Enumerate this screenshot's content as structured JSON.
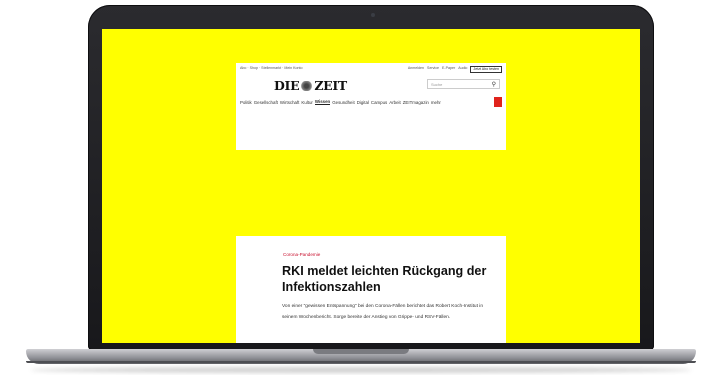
{
  "header": {
    "topbar_left": "Abo · Shop · Stellenmarkt · Mein Konto",
    "topbar_right_items": [
      "Anmelden",
      "Service",
      "E-Paper",
      "Audio"
    ],
    "topbar_login": "Jetzt Abo testen",
    "logo_left": "DIE",
    "logo_right": "ZEIT",
    "search_placeholder": "Suche",
    "nav": [
      "Politik",
      "Gesellschaft",
      "Wirtschaft",
      "Kultur",
      "Wissen",
      "Gesundheit",
      "Digital",
      "Campus",
      "Arbeit",
      "ZEITmagazin",
      "mehr"
    ],
    "nav_active_index": 4
  },
  "article": {
    "kicker": "Corona-Pandemie",
    "headline": "RKI meldet leichten Rückgang der Infektionszahlen",
    "teaser": "Von einer \"gewissen Entspannung\" bei den Corona-Fällen berichtet das Robert Koch-Institut in seinem Wochenbericht. Sorge bereite der Anstieg von Grippe- und RSV-Fällen."
  },
  "colors": {
    "screen_background": "#ffff00",
    "kicker": "#c8102e",
    "pdf_badge": "#e0231c"
  }
}
